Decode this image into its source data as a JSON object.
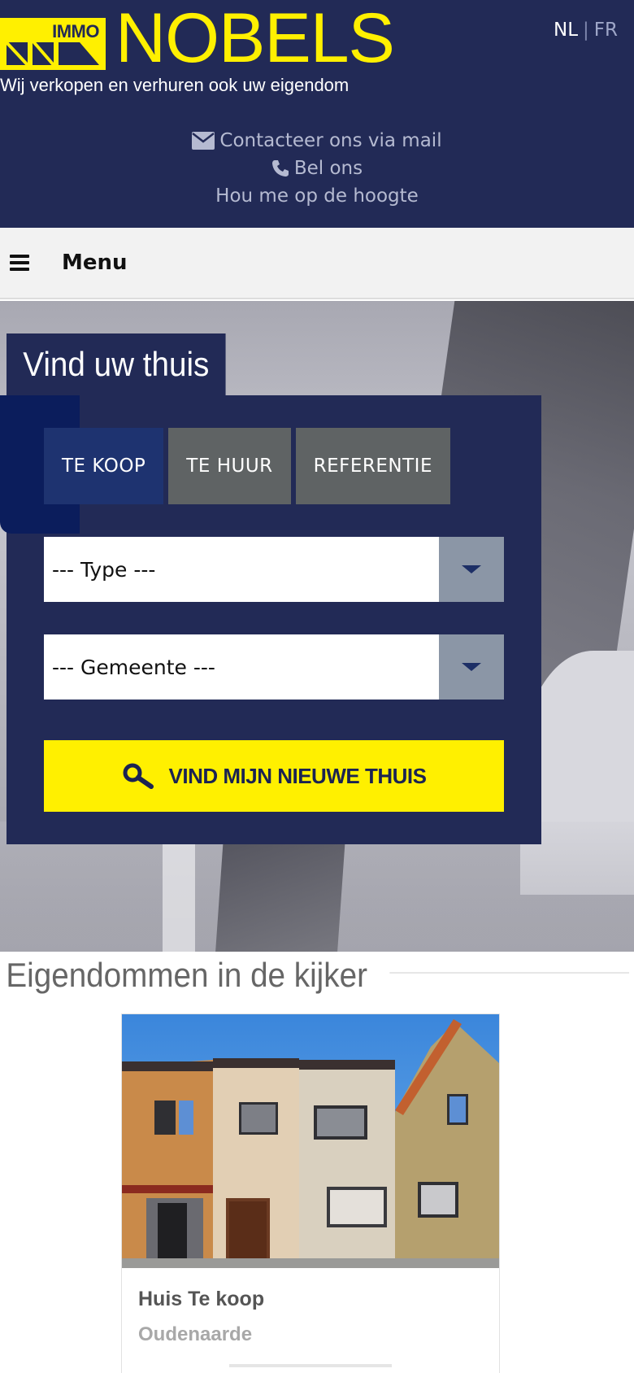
{
  "header": {
    "logo_small": "IMMO",
    "logo_name": "NOBELS",
    "tagline": "Wij verkopen en verhuren ook uw eigendom",
    "lang_nl": "NL",
    "lang_sep": "|",
    "lang_fr": "FR",
    "contact_mail": "Contacteer ons via mail",
    "contact_call": "Bel ons",
    "contact_news": "Hou me op de hoogte"
  },
  "menubar": {
    "label": "Menu"
  },
  "search": {
    "title": "Vind uw thuis",
    "tabs": [
      {
        "label": "TE KOOP",
        "active": true
      },
      {
        "label": "TE HUUR",
        "active": false
      },
      {
        "label": "REFERENTIE",
        "active": false
      }
    ],
    "type_select": "--- Type ---",
    "gemeente_select": "--- Gemeente ---",
    "button_label": "VIND MIJN NIEUWE THUIS"
  },
  "featured": {
    "title": "Eigendommen in de kijker",
    "card": {
      "title": "Huis Te koop",
      "location": "Oudenaarde"
    }
  },
  "colors": {
    "brand_navy": "#222a56",
    "brand_yellow": "#fff000",
    "tab_active": "#1e3370",
    "tab_inactive": "#5f6364"
  },
  "icons": [
    "envelope-icon",
    "phone-icon",
    "hamburger-icon",
    "search-icon",
    "chevron-down-icon"
  ]
}
